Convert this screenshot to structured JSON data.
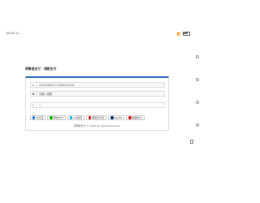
{
  "status_bar": {
    "time": "08:00:11",
    "signal": "📶 ",
    "battery_icon": "battery-icon"
  },
  "page": {
    "title": "捐赠者支付 · 捐款支付"
  },
  "form": {
    "order_id": "20220304271 9000210100",
    "name_placeholder": "请输入捐赠",
    "amount": "1",
    "order_icon": "≡",
    "name_icon": "☻",
    "amount_icon": "¥"
  },
  "buttons": [
    {
      "label": "支付宝",
      "color": "#1677ff",
      "icon": "alipay-icon"
    },
    {
      "label": "微信支付",
      "color": "#09bb07",
      "icon": "wechat-icon"
    },
    {
      "label": "QQ钱包",
      "color": "#12b7f5",
      "icon": "qq-icon"
    },
    {
      "label": "银联云闪付",
      "color": "#e60012",
      "icon": "unionpay-icon"
    },
    {
      "label": "PayPal",
      "color": "#003087",
      "icon": "paypal-icon"
    },
    {
      "label": "数据支付",
      "color": "#e02020",
      "icon": "data-pay-icon"
    }
  ],
  "footer": {
    "copyright": "捐赠者支付 © 2022 All rights Reserved."
  }
}
